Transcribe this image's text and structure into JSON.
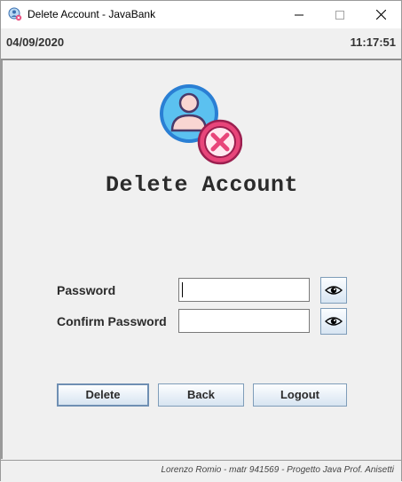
{
  "window": {
    "title": "Delete Account - JavaBank"
  },
  "infobar": {
    "date": "04/09/2020",
    "time": "11:17:51"
  },
  "main": {
    "heading": "Delete Account",
    "avatar_icon": "user-delete-icon",
    "password_label": "Password",
    "password_value": "",
    "confirm_label": "Confirm Password",
    "confirm_value": "",
    "show_password_icon": "eye-icon"
  },
  "actions": {
    "delete_label": "Delete",
    "back_label": "Back",
    "logout_label": "Logout"
  },
  "footer": {
    "credits": "Lorenzo Romio - matr 941569 - Progetto Java Prof. Anisetti"
  },
  "colors": {
    "avatar_ring": "#2a7fd4",
    "avatar_fill": "#5bc1f0",
    "delete_badge": "#e8457a",
    "button_border": "#7f9db9"
  }
}
